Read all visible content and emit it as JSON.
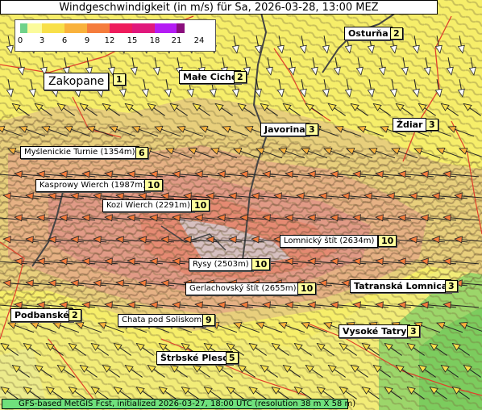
{
  "title": "Windgeschwindigkeit (in m/s) für Sa, 2026-03-28, 13:00 MEZ",
  "legend": {
    "ticks": [
      "0",
      "3",
      "6",
      "9",
      "12",
      "15",
      "18",
      "21",
      "24"
    ],
    "colors": [
      "#6fd28a",
      "#fbfb9c",
      "#f8e04a",
      "#f9b23c",
      "#f57c3c",
      "#ee1c5c",
      "#e0187c",
      "#b41cf4",
      "#8a0e7c"
    ]
  },
  "places": [
    {
      "name": "Osturňa",
      "value": "2"
    },
    {
      "name": "Zakopane",
      "value": "1"
    },
    {
      "name": "Małe Ciche",
      "value": "2"
    },
    {
      "name": "Ždiar",
      "value": "3"
    },
    {
      "name": "Javorina",
      "value": "3"
    },
    {
      "name": "Tatranská Lomnica",
      "value": "3"
    },
    {
      "name": "Podbanské",
      "value": "2"
    },
    {
      "name": "Vysoké Tatry",
      "value": "3"
    },
    {
      "name": "Štrbské Pleso",
      "value": "5"
    }
  ],
  "peaks": [
    {
      "name": "Myślenickie Turnie (1354m)",
      "value": "6"
    },
    {
      "name": "Kasprowy Wierch (1987m)",
      "value": "10"
    },
    {
      "name": "Kozi Wierch (2291m)",
      "value": "10"
    },
    {
      "name": "Lomnický štít (2634m)",
      "value": "10"
    },
    {
      "name": "Rysy (2503m)",
      "value": "10"
    },
    {
      "name": "Gerlachovský štít (2655m)",
      "value": "10"
    },
    {
      "name": "Chata pod Soliskom",
      "value": "9"
    }
  ],
  "footer": "GFS-based MetGIS Fcst, initialized 2026-03-27, 18:00 UTC  (resolution 38 m X 58 m)"
}
